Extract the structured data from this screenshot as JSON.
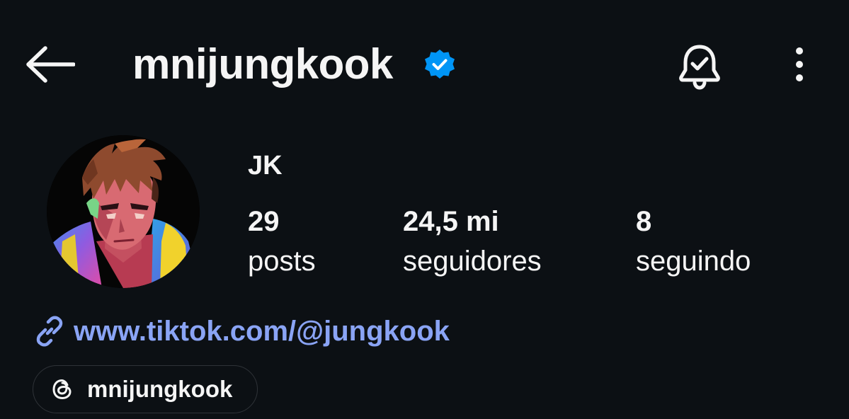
{
  "header": {
    "username": "mnijungkook",
    "back_icon": "arrow-left-icon",
    "verified_icon": "verified-badge-icon",
    "notification_icon": "bell-check-icon",
    "more_icon": "vertical-dots-icon"
  },
  "profile": {
    "display_name": "JK",
    "avatar_icon": "cartoon-avatar"
  },
  "stats": {
    "posts": {
      "value": "29",
      "label": "posts"
    },
    "followers": {
      "value": "24,5 mi",
      "label": "seguidores"
    },
    "following": {
      "value": "8",
      "label": "seguindo"
    }
  },
  "bio_link": {
    "text": "www.tiktok.com/@jungkook",
    "icon": "link-icon"
  },
  "threads": {
    "handle": "mnijungkook",
    "icon": "threads-icon"
  },
  "colors": {
    "background": "#0c1014",
    "text": "#f5f5f5",
    "link": "#8aa4f5",
    "verified": "#0095f6",
    "pill_border": "#2f3338"
  }
}
